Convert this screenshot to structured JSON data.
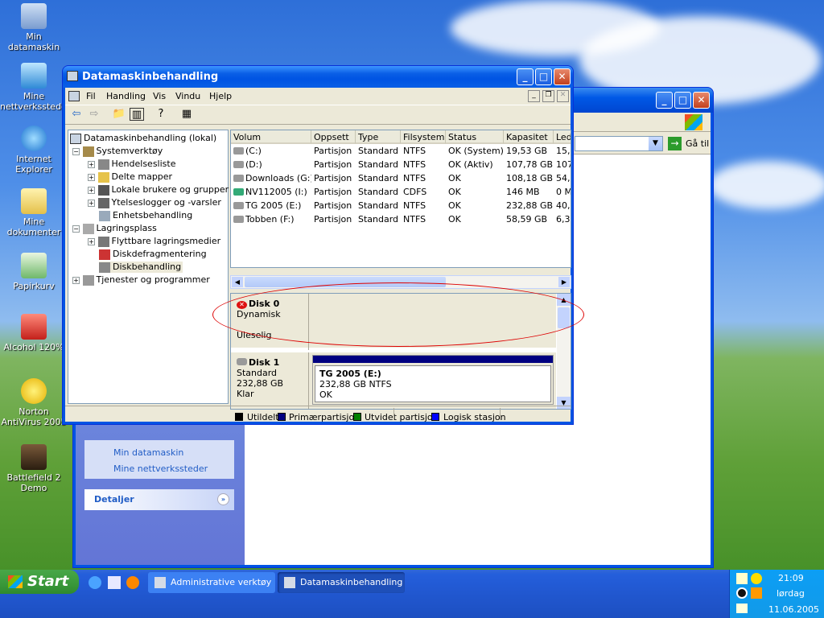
{
  "desktop": {
    "icons": [
      {
        "label": "Min datamaskin"
      },
      {
        "label": "Mine nettverkssteder"
      },
      {
        "label": "Internet Explorer"
      },
      {
        "label": "Mine dokumenter"
      },
      {
        "label": "Papirkurv"
      },
      {
        "label": "Alcohol 120%"
      },
      {
        "label": "Norton AntiVirus 2005"
      },
      {
        "label": "Battlefield 2 Demo"
      }
    ]
  },
  "background_window": {
    "goto_label": "Gå til",
    "sidebar_links": [
      "Min datamaskin",
      "Mine nettverkssteder"
    ],
    "details_label": "Detaljer"
  },
  "window": {
    "title": "Datamaskinbehandling",
    "menu": [
      "Fil",
      "Handling",
      "Vis",
      "Vindu",
      "Hjelp"
    ],
    "tree": [
      {
        "label": "Datamaskinbehandling (lokal)"
      },
      {
        "label": "Systemverktøy"
      },
      {
        "label": "Hendelsesliste"
      },
      {
        "label": "Delte mapper"
      },
      {
        "label": "Lokale brukere og grupper"
      },
      {
        "label": "Ytelseslogger og -varsler"
      },
      {
        "label": "Enhetsbehandling"
      },
      {
        "label": "Lagringsplass"
      },
      {
        "label": "Flyttbare lagringsmedier"
      },
      {
        "label": "Diskdefragmentering"
      },
      {
        "label": "Diskbehandling"
      },
      {
        "label": "Tjenester og programmer"
      }
    ],
    "columns": [
      "Volum",
      "Oppsett",
      "Type",
      "Filsystem",
      "Status",
      "Kapasitet",
      "Led"
    ],
    "volumes": [
      [
        "(C:)",
        "Partisjon",
        "Standard",
        "NTFS",
        "OK (System)",
        "19,53 GB",
        "15,"
      ],
      [
        "(D:)",
        "Partisjon",
        "Standard",
        "NTFS",
        "OK (Aktiv)",
        "107,78 GB",
        "107"
      ],
      [
        "Downloads (G:)",
        "Partisjon",
        "Standard",
        "NTFS",
        "OK",
        "108,18 GB",
        "54,"
      ],
      [
        "NV112005 (I:)",
        "Partisjon",
        "Standard",
        "CDFS",
        "OK",
        "146 MB",
        "0 M"
      ],
      [
        "TG 2005 (E:)",
        "Partisjon",
        "Standard",
        "NTFS",
        "OK",
        "232,88 GB",
        "40,"
      ],
      [
        "Tobben (F:)",
        "Partisjon",
        "Standard",
        "NTFS",
        "OK",
        "58,59 GB",
        "6,3"
      ]
    ],
    "disks": [
      {
        "name": "Disk 0",
        "type": "Dynamisk",
        "state": "Uleselig"
      },
      {
        "name": "Disk 1",
        "type": "Standard",
        "size": "232,88 GB",
        "state": "Klar",
        "partition": {
          "name": "TG 2005  (E:)",
          "info": "232,88 GB NTFS",
          "status": "OK"
        }
      }
    ],
    "legend": [
      {
        "label": "Utildelt",
        "color": "#000000"
      },
      {
        "label": "Primærpartisjon",
        "color": "#000080"
      },
      {
        "label": "Utvidet partisjon",
        "color": "#008000"
      },
      {
        "label": "Logisk stasjon",
        "color": "#0000ff"
      }
    ]
  },
  "taskbar": {
    "start_label": "Start",
    "buttons": [
      "Administrative verktøy",
      "Datamaskinbehandling"
    ],
    "clock": {
      "time": "21:09",
      "day": "lørdag",
      "date": "11.06.2005"
    }
  }
}
